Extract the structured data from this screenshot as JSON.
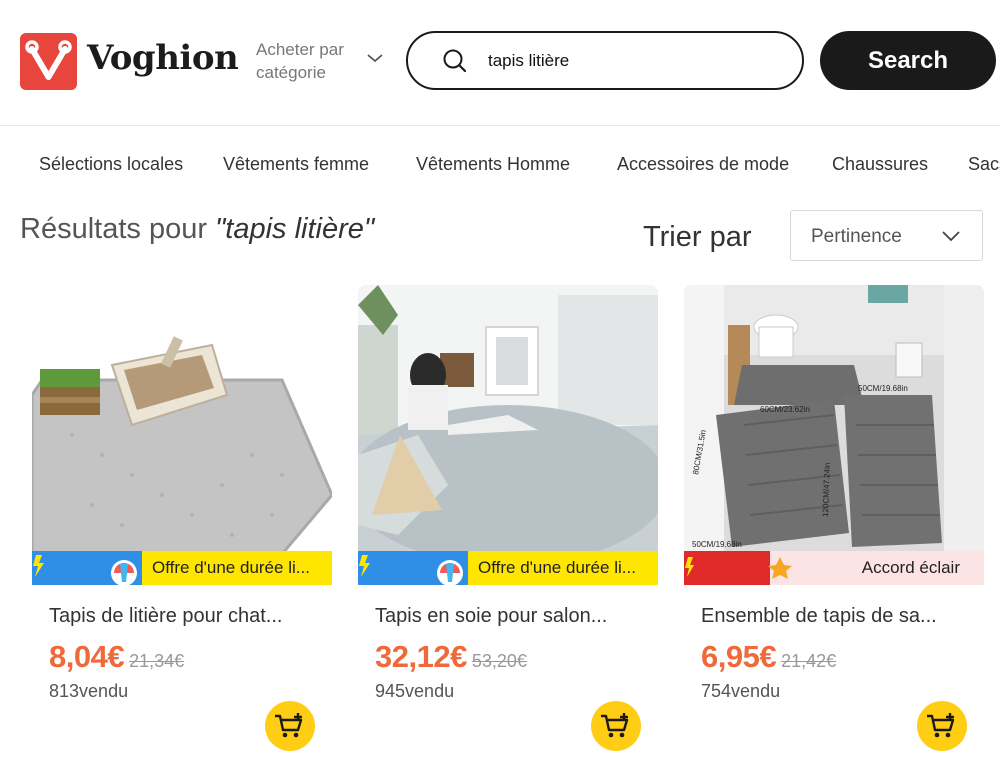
{
  "header": {
    "brand": "Voghion",
    "category_line1": "Acheter par",
    "category_line2": "catégorie",
    "search_value": "tapis litière",
    "search_button": "Search"
  },
  "nav": {
    "items": [
      {
        "label": "Sélections locales"
      },
      {
        "label": "Vêtements femme"
      },
      {
        "label": "Vêtements Homme"
      },
      {
        "label": "Accessoires de mode"
      },
      {
        "label": "Chaussures"
      },
      {
        "label": "Sacs"
      }
    ]
  },
  "results": {
    "prefix": "Résultats pour",
    "query": "\"tapis litière\"",
    "sort_label": "Trier par",
    "sort_value": "Pertinence"
  },
  "products": [
    {
      "title": "Tapis de litière pour chat...",
      "price": "8,04€",
      "old_price": "21,34€",
      "sold_count": "813",
      "sold_label": "vendu",
      "deal_badge": "LIGHTNING DEAL",
      "deal_text": "Offre d'une durée li...",
      "deal_style": "yellow",
      "image": "litter-box-mat-photo"
    },
    {
      "title": "Tapis en soie pour salon...",
      "price": "32,12€",
      "old_price": "53,20€",
      "sold_count": "945",
      "sold_label": "vendu",
      "deal_badge": "LIGHTNING DEAL",
      "deal_text": "Offre d'une durée li...",
      "deal_style": "yellow",
      "image": "living-room-rug-photo"
    },
    {
      "title": "Ensemble de tapis de sa...",
      "price": "6,95€",
      "old_price": "21,42€",
      "sold_count": "754",
      "sold_label": "vendu",
      "deal_badge": "Lightning deal",
      "deal_text": "Accord éclair",
      "deal_style": "pink",
      "image": "bathroom-mat-set-photo",
      "image_labels": [
        "60CM/23.62in",
        "50CM/19.68in",
        "80CM/31.5in",
        "120CM/47.24in",
        "50CM/19.68in"
      ]
    }
  ],
  "colors": {
    "brand_red": "#e8453c",
    "price_orange": "#ee6a3a",
    "cart_yellow": "#ffcd14",
    "deal_yellow": "#ffe600",
    "search_black": "#1a1a1a"
  }
}
